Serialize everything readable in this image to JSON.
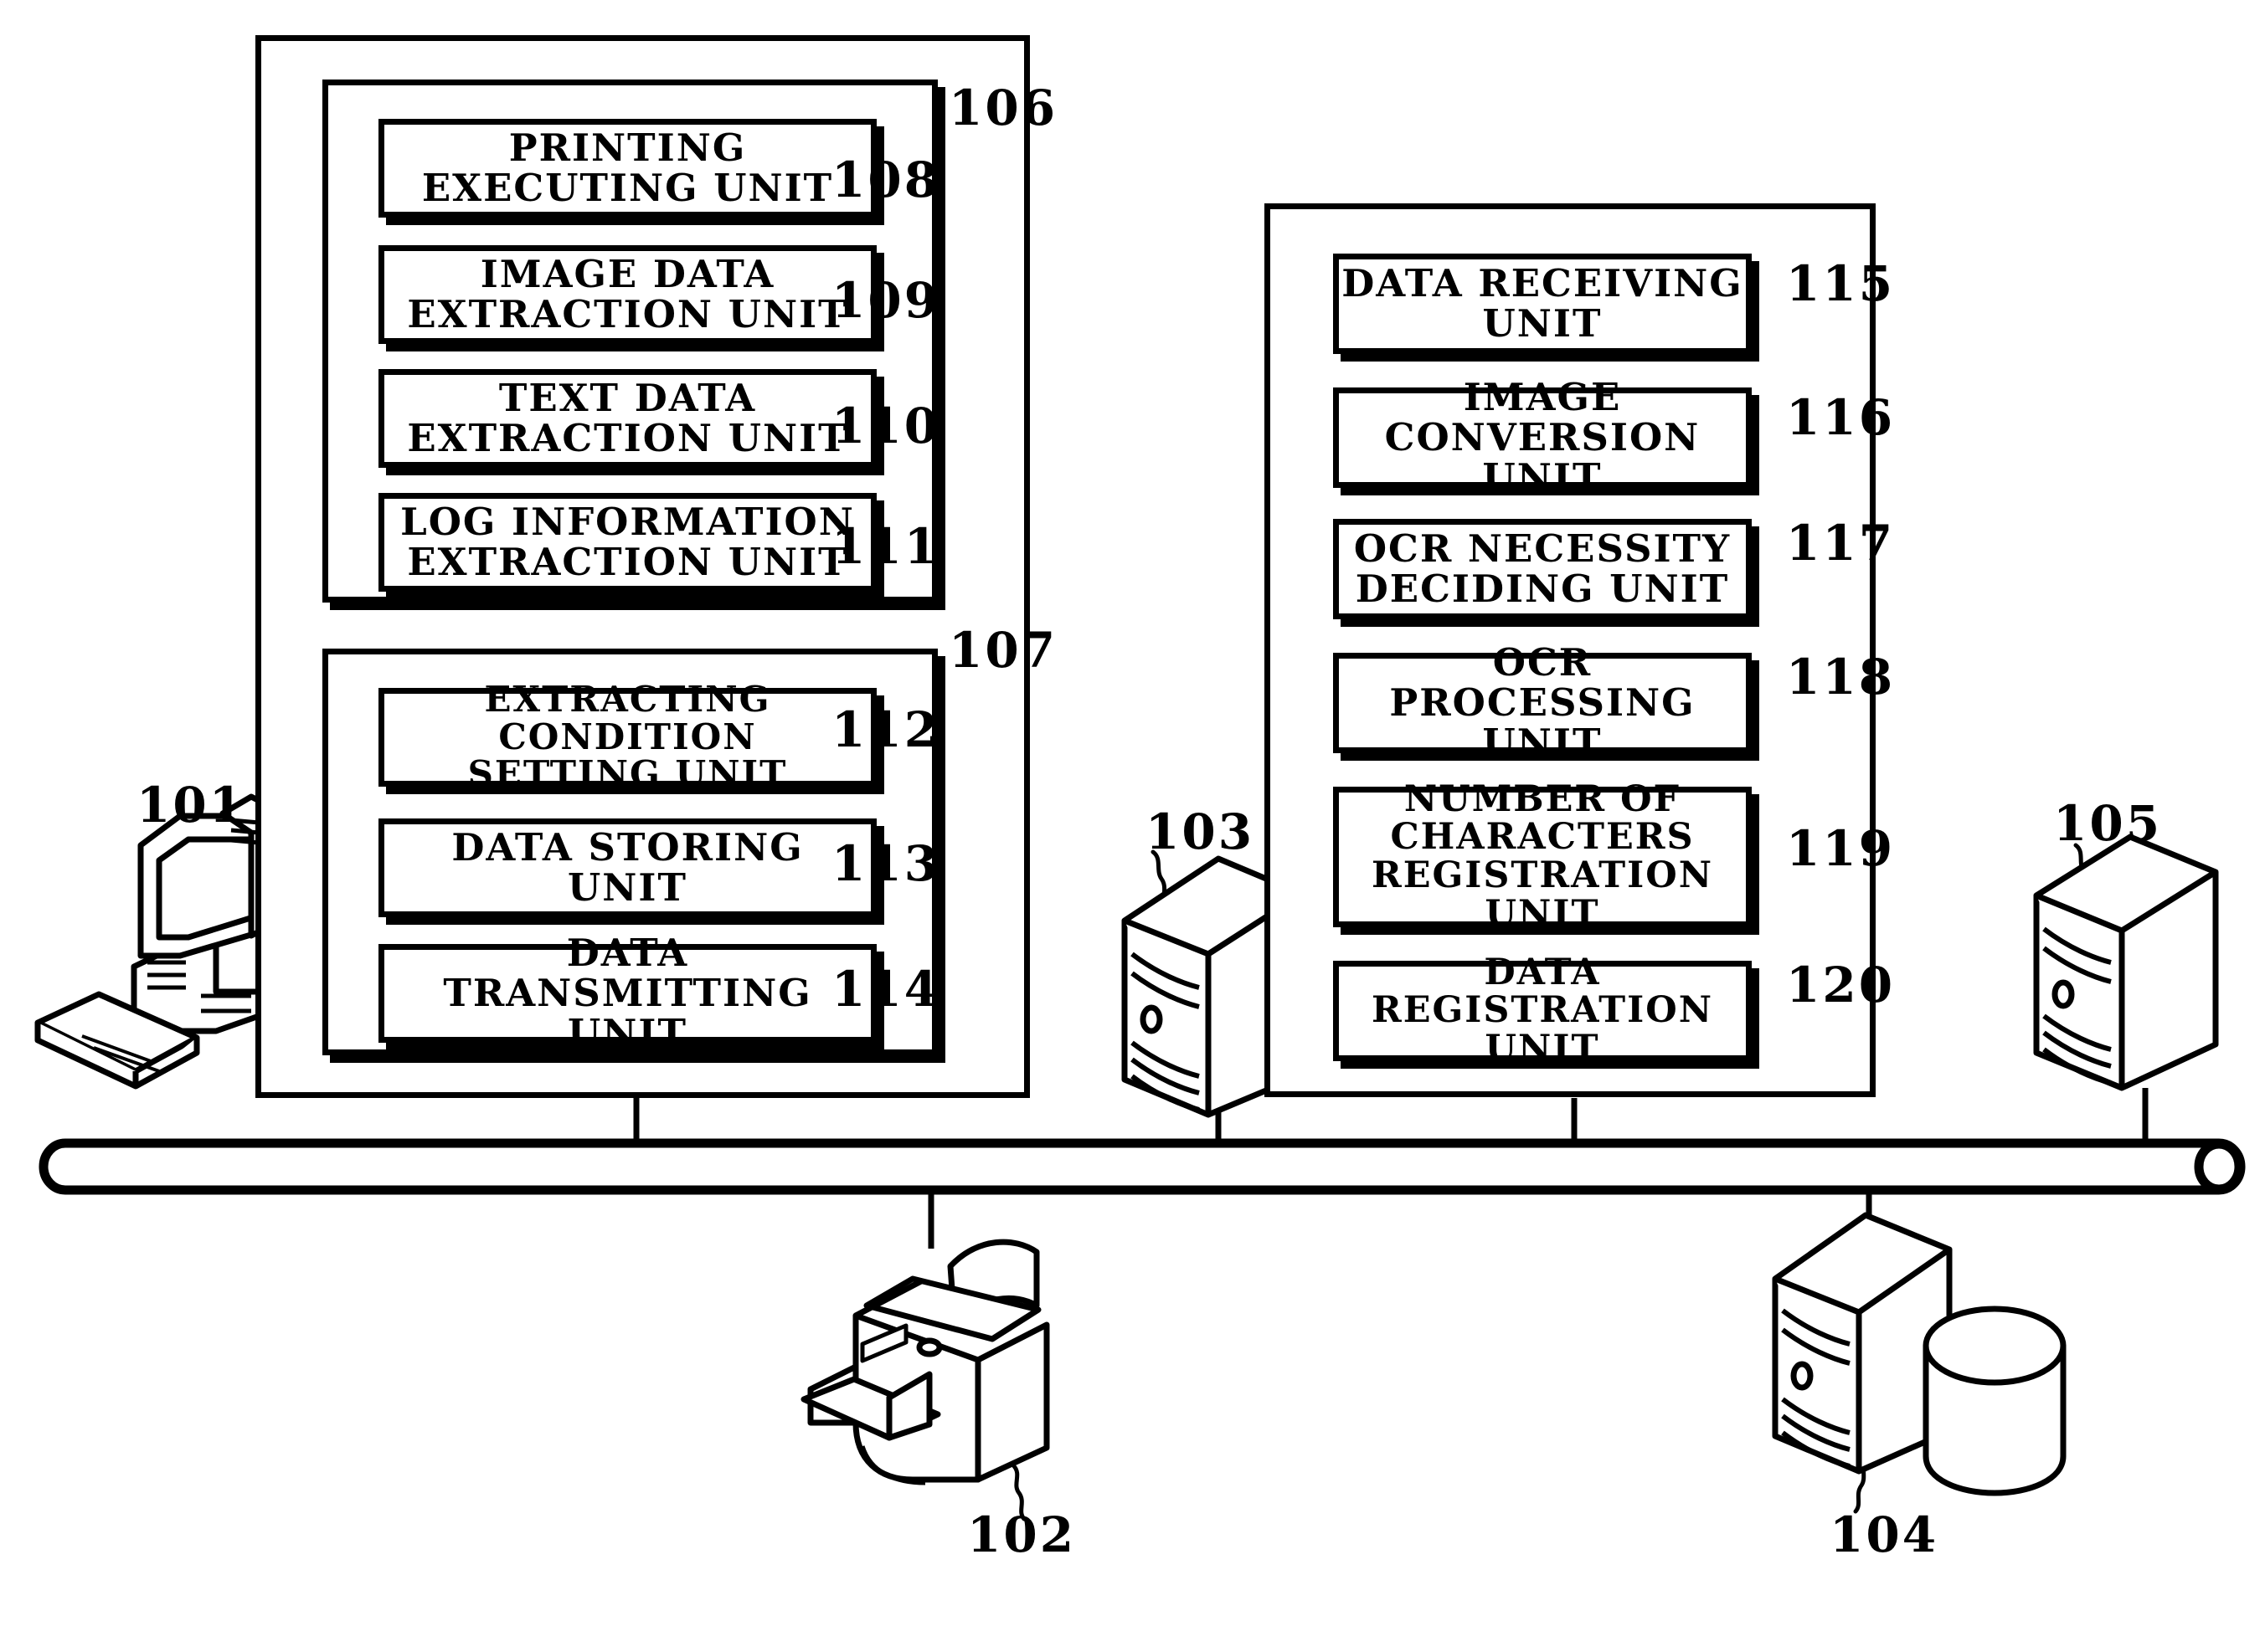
{
  "figure": {
    "kind": "patent-system-block-diagram",
    "background": "#ffffff",
    "ink": "#000000"
  },
  "client_system": {
    "ref": "101",
    "outer_panel_ref": "",
    "groups": [
      {
        "ref": "106",
        "units": [
          {
            "ref": "108",
            "label": "PRINTING\nEXECUTING UNIT"
          },
          {
            "ref": "109",
            "label": "IMAGE DATA\nEXTRACTION UNIT"
          },
          {
            "ref": "110",
            "label": "TEXT DATA\nEXTRACTION UNIT"
          },
          {
            "ref": "111",
            "label": "LOG INFORMATION\nEXTRACTION UNIT"
          }
        ]
      },
      {
        "ref": "107",
        "units": [
          {
            "ref": "112",
            "label": "EXTRACTING CONDITION\nSETTING UNIT"
          },
          {
            "ref": "113",
            "label": "DATA STORING\nUNIT"
          },
          {
            "ref": "114",
            "label": "DATA TRANSMITTING\nUNIT"
          }
        ]
      }
    ]
  },
  "server_system": {
    "ref": "103",
    "groups": [
      {
        "ref": "",
        "units": [
          {
            "ref": "115",
            "label": "DATA RECEIVING\nUNIT"
          },
          {
            "ref": "116",
            "label": "IMAGE\nCONVERSION UNIT"
          },
          {
            "ref": "117",
            "label": "OCR NECESSITY\nDECIDING UNIT"
          },
          {
            "ref": "118",
            "label": "OCR PROCESSING\nUNIT"
          },
          {
            "ref": "119",
            "label": "NUMBER OF\nCHARACTERS\nREGISTRATION UNIT"
          },
          {
            "ref": "120",
            "label": "DATA REGISTRATION\nUNIT"
          }
        ]
      }
    ]
  },
  "devices": [
    {
      "ref": "101",
      "icon": "desktop-computer-icon",
      "name": "client-computer"
    },
    {
      "ref": "102",
      "icon": "printer-icon",
      "name": "printer"
    },
    {
      "ref": "103",
      "icon": "server-tower-icon",
      "name": "server"
    },
    {
      "ref": "104",
      "icon": "server-with-database-icon",
      "name": "database-server"
    },
    {
      "ref": "105",
      "icon": "server-tower-icon",
      "name": "secondary-server"
    }
  ],
  "network": {
    "name": "network-bus",
    "label": ""
  }
}
